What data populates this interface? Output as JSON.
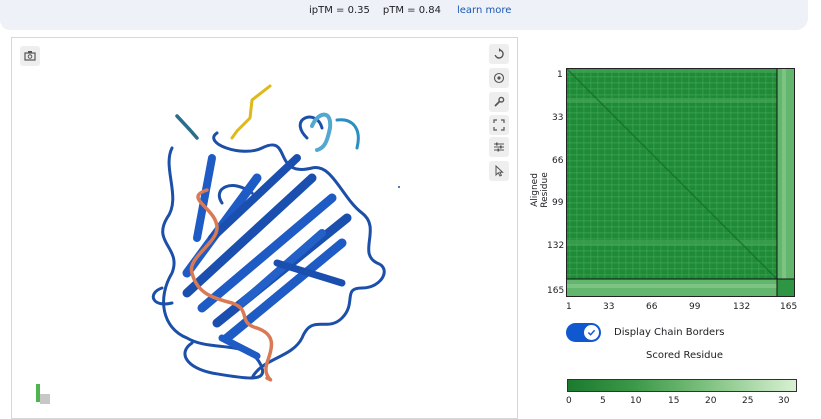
{
  "header": {
    "iptm": "ipTM = 0.35",
    "ptm": "pTM = 0.84",
    "learn_more": "learn more"
  },
  "viewer": {
    "tools": [
      "reset-view-icon",
      "center-icon",
      "wrench-icon",
      "fullscreen-icon",
      "sliders-icon",
      "cursor-icon"
    ],
    "left_tool": "screenshot-icon"
  },
  "pae": {
    "y_axis_label": "Aligned Residue",
    "y_ticks": [
      "1",
      "33",
      "66",
      "99",
      "132",
      "165"
    ],
    "x_ticks": [
      "1",
      "33",
      "66",
      "99",
      "132",
      "165"
    ],
    "display_chain_borders_label": "Display Chain Borders",
    "display_chain_borders_on": true,
    "scored_residue_label": "Scored Residue",
    "colorbar_ticks": [
      "0",
      "5",
      "10",
      "15",
      "20",
      "25",
      "30"
    ],
    "colors": {
      "low": "#1b7a2e",
      "high": "#eaf6e6",
      "accent": "#1058d0"
    }
  }
}
